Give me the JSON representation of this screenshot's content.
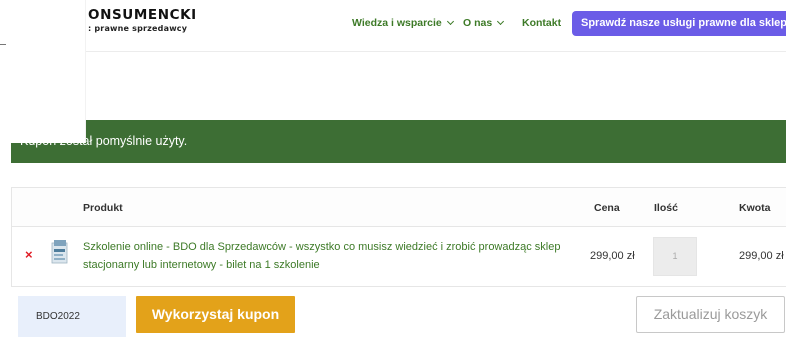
{
  "header": {
    "logo_main": "ONSUMENCKI",
    "logo_sub": ": prawne sprzedawcy",
    "nav": [
      {
        "label": "Wiedza i wsparcie",
        "dropdown": true
      },
      {
        "label": "O nas",
        "dropdown": true
      },
      {
        "label": "Kontakt",
        "dropdown": false
      }
    ],
    "cta_label": "Sprawdź nasze usługi prawne dla sklepów"
  },
  "notice": {
    "text": "Kupon został pomyślnie użyty."
  },
  "cart": {
    "columns": {
      "product": "Produkt",
      "price": "Cena",
      "quantity": "Ilość",
      "total": "Kwota"
    },
    "items": [
      {
        "remove_symbol": "×",
        "name": "Szkolenie online - BDO dla Sprzedawców - wszystko co musisz wiedzieć i zrobić prowadząc sklep stacjonarny lub internetowy - bilet na 1 szkolenie",
        "price": "299,00 zł",
        "quantity": "1",
        "total": "299,00 zł"
      }
    ]
  },
  "coupon": {
    "code": "BDO2022",
    "apply_label": "Wykorzystaj kupon",
    "update_label": "Zaktualizuj koszyk"
  },
  "colors": {
    "brand_green": "#3d7a27",
    "notice_bg": "#3d6e34",
    "cta_purple": "#6b5ce7",
    "coupon_orange": "#e3a21a",
    "remove_red": "#e01b24"
  },
  "icons": {
    "remove": "close-icon",
    "dropdown": "chevron-down-icon",
    "product": "product-thumbnail"
  }
}
